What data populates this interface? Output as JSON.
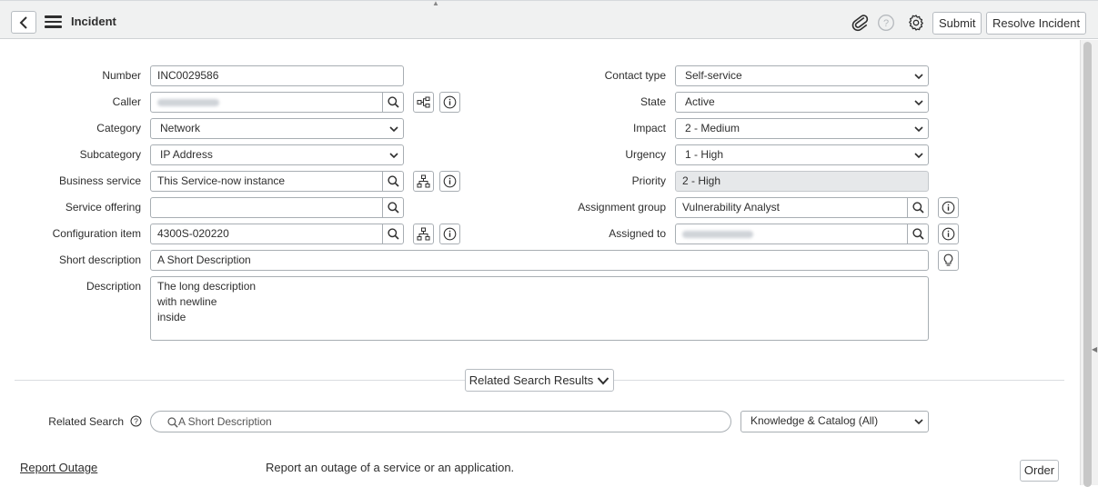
{
  "header": {
    "title": "Incident",
    "submit_label": "Submit",
    "resolve_label": "Resolve Incident",
    "icons": [
      "back-icon",
      "hamburger-icon",
      "paperclip-icon",
      "help-icon",
      "gear-icon"
    ]
  },
  "left_fields": [
    {
      "label": "Number",
      "value": "INC0029586"
    },
    {
      "label": "Caller",
      "value": ""
    },
    {
      "label": "Category",
      "value": "Network"
    },
    {
      "label": "Subcategory",
      "value": "IP Address"
    },
    {
      "label": "Business service",
      "value": "This Service-now instance"
    },
    {
      "label": "Service offering",
      "value": ""
    },
    {
      "label": "Configuration item",
      "value": "4300S-020220"
    }
  ],
  "right_fields": [
    {
      "label": "Contact type",
      "value": "Self-service"
    },
    {
      "label": "State",
      "value": "Active"
    },
    {
      "label": "Impact",
      "value": "2 - Medium"
    },
    {
      "label": "Urgency",
      "value": "1 - High"
    },
    {
      "label": "Priority",
      "value": "2 - High"
    },
    {
      "label": "Assignment group",
      "value": "Vulnerability Analyst"
    },
    {
      "label": "Assigned to",
      "value": ""
    }
  ],
  "short_description": {
    "label": "Short description",
    "value": "A Short Description"
  },
  "description": {
    "label": "Description",
    "value": "The long description\nwith newline\ninside"
  },
  "related": {
    "toggle_label": "Related Search Results",
    "search_label": "Related Search",
    "search_value": "A Short Description",
    "scope_value": "Knowledge & Catalog (All)"
  },
  "results": [
    {
      "title": "Report Outage",
      "description": "Report an outage of a service or an application.",
      "action": "Order"
    }
  ]
}
